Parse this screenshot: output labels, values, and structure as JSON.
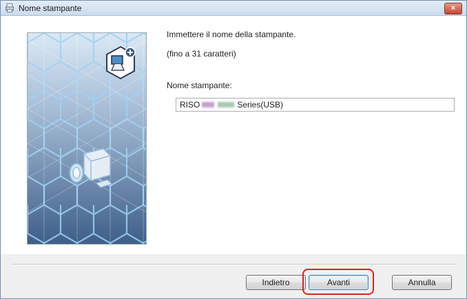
{
  "window": {
    "title": "Nome stampante",
    "close_label": "×"
  },
  "content": {
    "instruction": "Immettere il nome della stampante.",
    "limit_note": "(fino a 31 caratteri)",
    "field_label": "Nome stampante:",
    "field_value_prefix": "RISO",
    "field_value_suffix": "Series(USB)"
  },
  "icons": {
    "title": "printer-icon",
    "badge": "computer-add-icon",
    "printer": "printer-illustration"
  },
  "buttons": {
    "back_label": "Indietro",
    "next_label": "Avanti",
    "cancel_label": "Annulla"
  },
  "colors": {
    "accent_highlight": "#e02020",
    "side_gradient_top": "#dbe8f4",
    "side_gradient_bottom": "#3e5f88",
    "hex_lines": "#9fd2f5"
  }
}
